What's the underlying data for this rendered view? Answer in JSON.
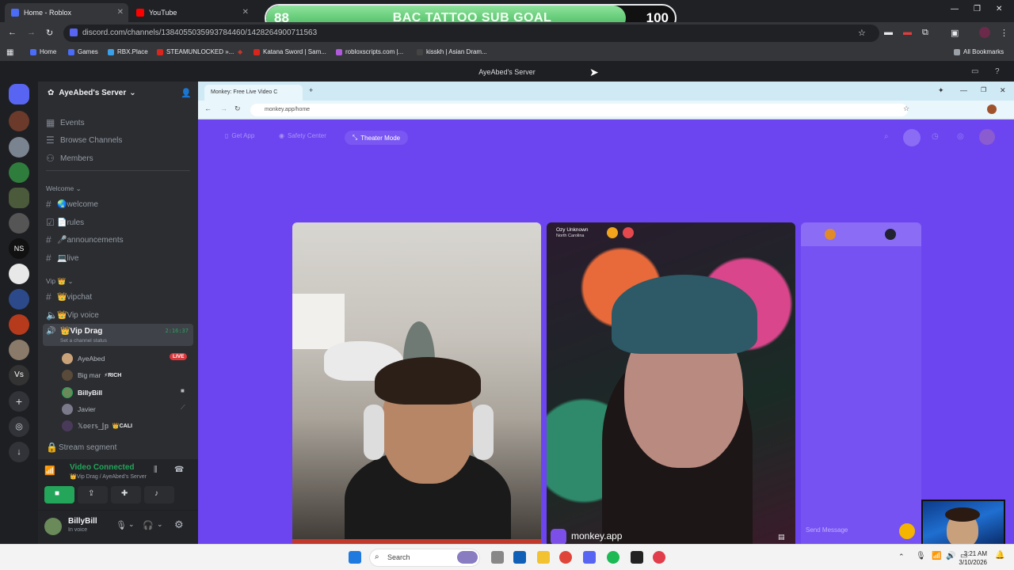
{
  "browser": {
    "tabs": [
      {
        "label": "Home - Roblox"
      },
      {
        "label": "YouTube"
      }
    ],
    "url": "discord.com/channels/1384055035993784460/1428264900711563",
    "bookmarks": [
      "Home",
      "Games",
      "RBX.Place",
      "STEAMUNLOCKED »...",
      "Katana Sword | Sam...",
      "robloxscripts.com |...",
      "kisskh | Asian Dram..."
    ],
    "all_bookmarks": "All Bookmarks"
  },
  "overlay": {
    "goal_start": "88",
    "goal_title": "BAC TATTOO SUB GOAL",
    "goal_end": "100",
    "progress_fraction": 0.88
  },
  "discord": {
    "window_title": "AyeAbed's Server",
    "server_name": "AyeAbed's Server",
    "nav": [
      "Events",
      "Browse Channels",
      "Members"
    ],
    "cat_welcome": "Welcome",
    "welcome_channels": [
      {
        "label": "🌏welcome"
      },
      {
        "label": "📄rules"
      },
      {
        "label": "🎤announcements"
      },
      {
        "label": "💻live"
      }
    ],
    "cat_vip": "Vip 👑",
    "vip_channels": [
      {
        "label": "👑vipchat"
      },
      {
        "label": "👑Vip voice"
      }
    ],
    "active_channel": "👑Vip Drag",
    "active_timer": "2:16:37",
    "channel_status": "Set a channel status",
    "voice_users": [
      {
        "name": "AyeAbed",
        "badge": "LIVE"
      },
      {
        "name": "Big mar",
        "badge": "⚡RICH"
      },
      {
        "name": "BillyBill",
        "badge": ""
      },
      {
        "name": "Javier",
        "badge": ""
      },
      {
        "name": "𝕏𝕠𝕖𝕣𝕤_𝕁𝕡",
        "badge": "👑CALI"
      }
    ],
    "stream_segment": "Stream segment",
    "vc_status": "Video Connected",
    "vc_location": "👑Vip Drag / AyeAbed's Server",
    "username": "BillyBill",
    "user_status": "In voice"
  },
  "inner": {
    "tab_title": "Monkey: Free Live Video C",
    "url": "monkey.app/home",
    "top_buttons": [
      "Get App",
      "Safety Center",
      "Theater Mode"
    ],
    "partner_name": "Ozy Unknown",
    "partner_location": "North Carolina",
    "watermark": "monkey.app",
    "send_placeholder": "Send Message"
  },
  "taskbar": {
    "search": "Search",
    "time": "3:21 AM",
    "date": "3/10/2026"
  },
  "colors": {
    "discord_bg": "#2b2d31",
    "monkey_purple": "#6c45f0",
    "live_red": "#da373c",
    "connected_green": "#23a55a"
  }
}
